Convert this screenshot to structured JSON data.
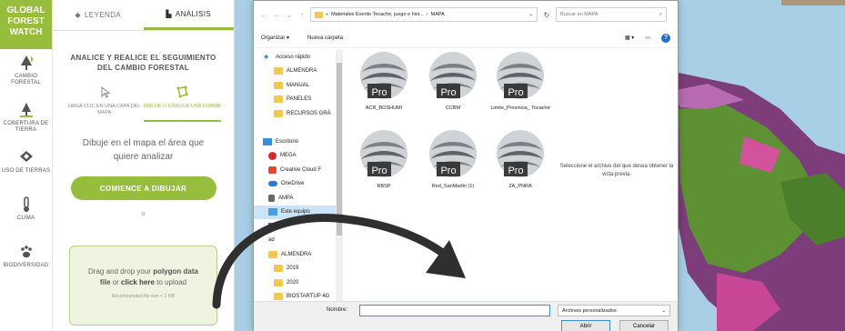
{
  "gfw": {
    "logo": [
      "GLOBAL",
      "FOREST",
      "WATCH"
    ],
    "nav": [
      {
        "label": "Cambio forestal",
        "icon": "tree-change-icon"
      },
      {
        "label": "Cobertura de tierra",
        "icon": "land-cover-icon"
      },
      {
        "label": "Uso de tierras",
        "icon": "land-use-icon"
      },
      {
        "label": "Clima",
        "icon": "thermometer-icon"
      },
      {
        "label": "Biodiversidad",
        "icon": "paw-icon"
      }
    ]
  },
  "panel": {
    "tabs": [
      {
        "label": "LEYENDA",
        "active": false
      },
      {
        "label": "ANÁLISIS",
        "active": true
      }
    ],
    "title": "ANALICE Y REALICE EL SEGUIMIENTO DEL CAMBIO FORESTAL",
    "modes": [
      {
        "label": "HAGA CLIC EN UNA CAPA DEL MAPA",
        "active": false
      },
      {
        "label": "DIBUJE O CARGUE UNA FORMA",
        "active": true
      }
    ],
    "instructions": "Dibuje en el mapa el área que quiere analizar",
    "start_button": "COMIENCE A DIBUJAR",
    "or": "o",
    "upload": {
      "text_1": "Drag and drop your ",
      "text_bold": "polygon data file",
      "text_2": " or ",
      "text_link": "click here",
      "text_3": " to upload",
      "hint": "Recommended file size < 1 MB"
    },
    "accent": "#97bd3d"
  },
  "dialog": {
    "path": [
      "Materiales Evento Tocache, juego e hist...",
      "MAPA"
    ],
    "search_placeholder": "Buscar en MAPA",
    "toolbar": {
      "organize": "Organizar ▾",
      "new_folder": "Nueva carpeta",
      "help": "?"
    },
    "tree": [
      {
        "label": "Acceso rápido",
        "icon": "star",
        "level": "top"
      },
      {
        "label": "ALMENDRA",
        "icon": "folder",
        "level": "sub"
      },
      {
        "label": "MANUAL",
        "icon": "folder",
        "level": "sub"
      },
      {
        "label": "PANELES",
        "icon": "folder",
        "level": "sub"
      },
      {
        "label": "RECURSOS GRÁ",
        "icon": "folder",
        "level": "sub"
      },
      {
        "label": "",
        "icon": "none",
        "level": "sub"
      },
      {
        "label": "Escritorio",
        "icon": "desk",
        "level": "top"
      },
      {
        "label": "MEGA",
        "icon": "mega",
        "level": "mid"
      },
      {
        "label": "Creative Cloud F",
        "icon": "cc",
        "level": "mid"
      },
      {
        "label": "OneDrive",
        "icon": "od",
        "level": "mid"
      },
      {
        "label": "AMPA",
        "icon": "user",
        "level": "mid"
      },
      {
        "label": "Este equipo",
        "icon": "pc",
        "level": "mid",
        "selected": true
      },
      {
        "label": "Bi",
        "icon": "lib",
        "level": "mid"
      },
      {
        "label": "ad",
        "icon": "none",
        "level": "mid"
      },
      {
        "label": "ALMENDRA",
        "icon": "folder",
        "level": "mid"
      },
      {
        "label": "2019",
        "icon": "folder",
        "level": "sub"
      },
      {
        "label": "2020",
        "icon": "folder",
        "level": "sub"
      },
      {
        "label": "BIOSTARTUP 4G",
        "icon": "folder",
        "level": "sub"
      }
    ],
    "files": [
      {
        "name": "ACR_BOSHUMI"
      },
      {
        "name": "CCBM"
      },
      {
        "name": "Limite_Provincia_ Tocache"
      },
      {
        "name": "RBSP"
      },
      {
        "name": "Red_SanMartin (1)"
      },
      {
        "name": "ZA_PNRA"
      }
    ],
    "badge": "Pro",
    "preview": "Seleccione el archivo del que desea obtener la vista previa.",
    "name_label": "Nombre:",
    "name_value": "",
    "filetype": "Archivos personalizados",
    "open": "Abrir",
    "cancel": "Cancelar"
  }
}
